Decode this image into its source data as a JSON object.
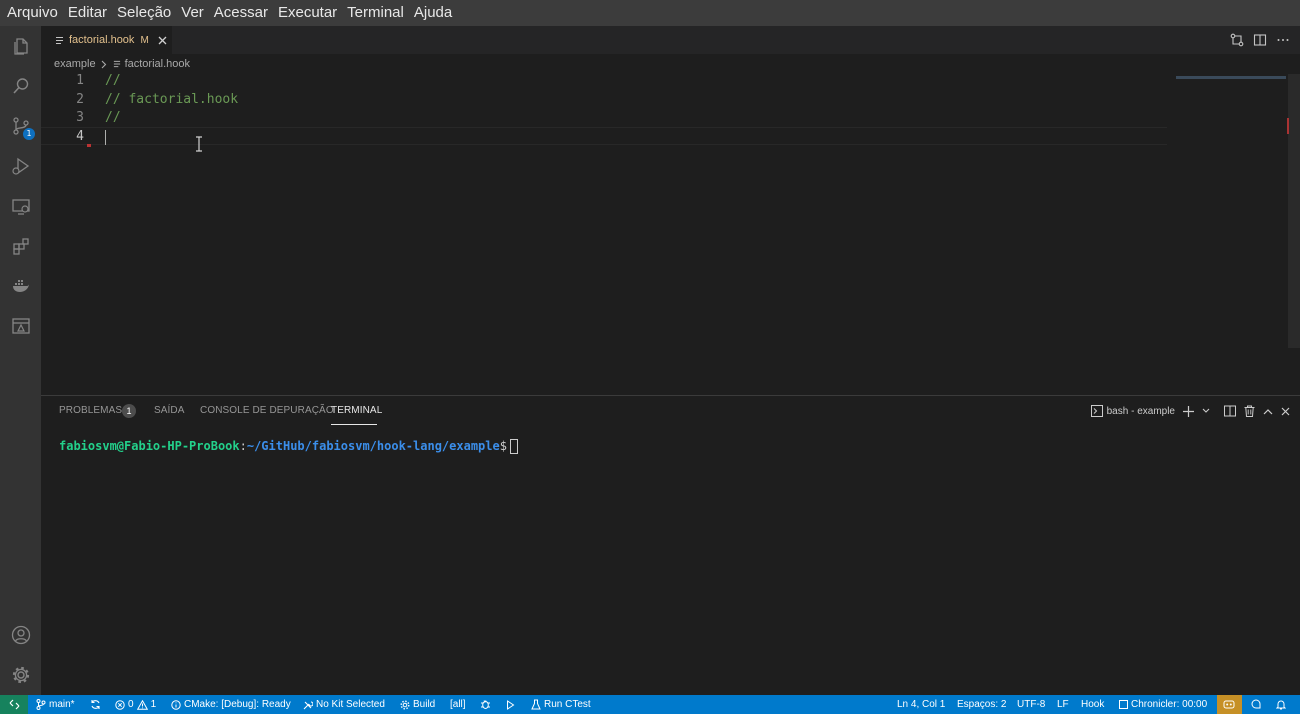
{
  "menu": [
    "Arquivo",
    "Editar",
    "Seleção",
    "Ver",
    "Acessar",
    "Executar",
    "Terminal",
    "Ajuda"
  ],
  "activity": {
    "scm_badge": "1"
  },
  "tab": {
    "name": "factorial.hook",
    "modified": "M"
  },
  "breadcrumb": {
    "folder": "example",
    "file": "factorial.hook"
  },
  "editor": {
    "lines": [
      {
        "num": "1",
        "text": "//"
      },
      {
        "num": "2",
        "text": "// factorial.hook"
      },
      {
        "num": "3",
        "text": "//"
      },
      {
        "num": "4",
        "text": ""
      }
    ]
  },
  "panel": {
    "tabs": [
      "PROBLEMAS",
      "SAÍDA",
      "CONSOLE DE DEPURAÇÃO",
      "TERMINAL"
    ],
    "problems_count": "1",
    "terminal_name": "bash - example",
    "prompt_user": "fabiosvm@Fabio-HP-ProBook",
    "prompt_path": "~/GitHub/fabiosvm/hook-lang/example",
    "prompt_symbol": "$"
  },
  "status": {
    "branch": "main*",
    "errors": "0",
    "warnings": "1",
    "cmake": "CMake: [Debug]: Ready",
    "kit": "No Kit Selected",
    "build": "Build",
    "target": "[all]",
    "ctest": "Run CTest",
    "position": "Ln 4, Col 1",
    "spaces": "Espaços: 2",
    "encoding": "UTF-8",
    "eol": "LF",
    "language": "Hook",
    "chronicler": "Chronicler: 00:00"
  },
  "colors": {
    "accent": "#007acc",
    "remote": "#16825d",
    "comment": "#6a9955",
    "terminal_user": "#23d18b",
    "terminal_path": "#3b8eea"
  }
}
